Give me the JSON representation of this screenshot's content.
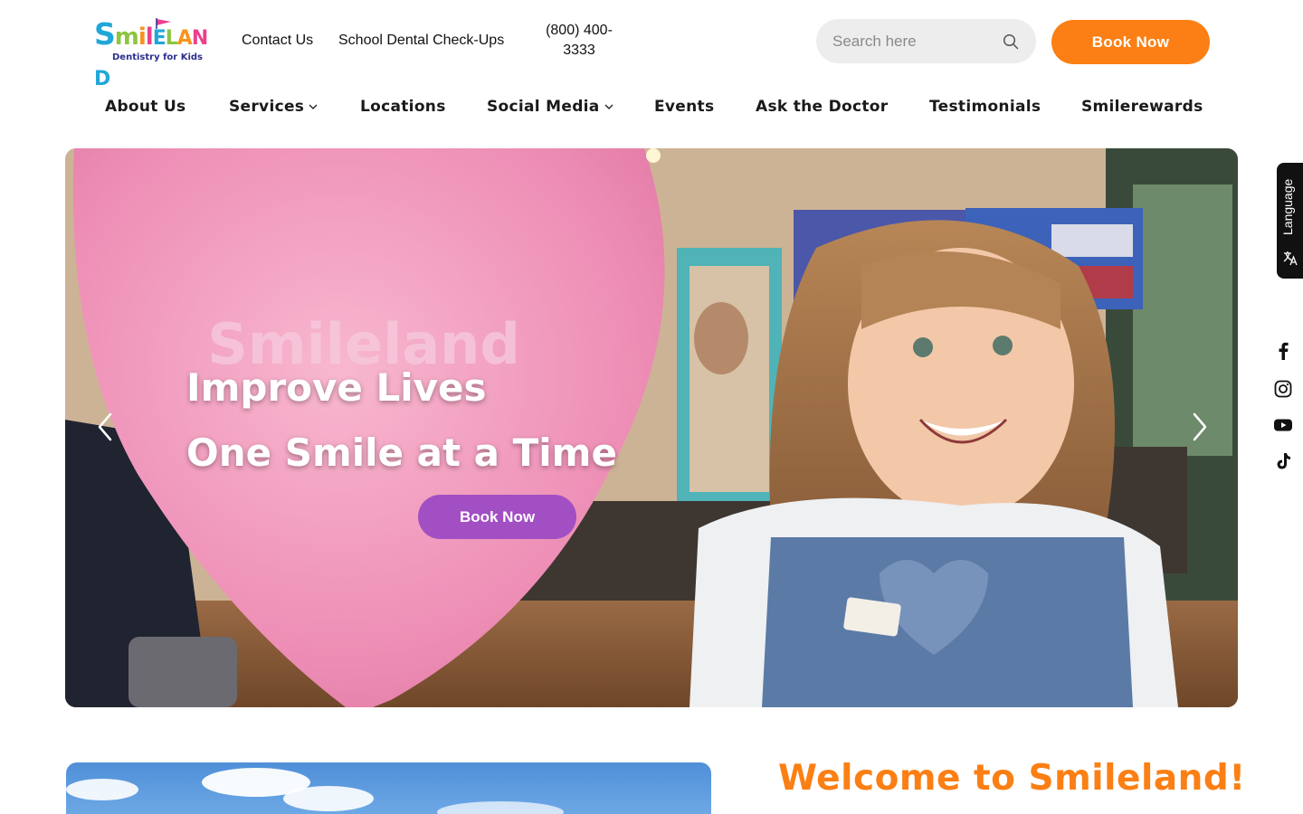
{
  "brand": {
    "logo_word": "Smileland",
    "tagline": "Dentistry for Kids"
  },
  "topbar": {
    "links": [
      {
        "label": "Contact Us"
      },
      {
        "label": "School Dental Check-Ups"
      }
    ],
    "phone": "(800) 400-3333",
    "search_placeholder": "Search here",
    "book_label": "Book Now"
  },
  "nav": {
    "items": [
      {
        "label": "About Us",
        "has_dropdown": false
      },
      {
        "label": "Services",
        "has_dropdown": true
      },
      {
        "label": "Locations",
        "has_dropdown": false
      },
      {
        "label": "Social Media",
        "has_dropdown": true
      },
      {
        "label": "Events",
        "has_dropdown": false
      },
      {
        "label": "Ask the Doctor",
        "has_dropdown": false
      },
      {
        "label": "Testimonials",
        "has_dropdown": false
      },
      {
        "label": "Smilerewards",
        "has_dropdown": false
      }
    ]
  },
  "hero": {
    "line1": "Improve Lives",
    "line2": "One Smile at a Time",
    "button_label": "Book Now",
    "balloon_text": "Smileland"
  },
  "rail": {
    "language_label": "Language",
    "social_icons": [
      "facebook-icon",
      "instagram-icon",
      "youtube-icon",
      "tiktok-icon"
    ]
  },
  "welcome": {
    "title": "Welcome to Smileland!"
  },
  "colors": {
    "accent_orange": "#fb7f14",
    "accent_purple": "#a24fc4",
    "search_bg": "#ededed"
  }
}
